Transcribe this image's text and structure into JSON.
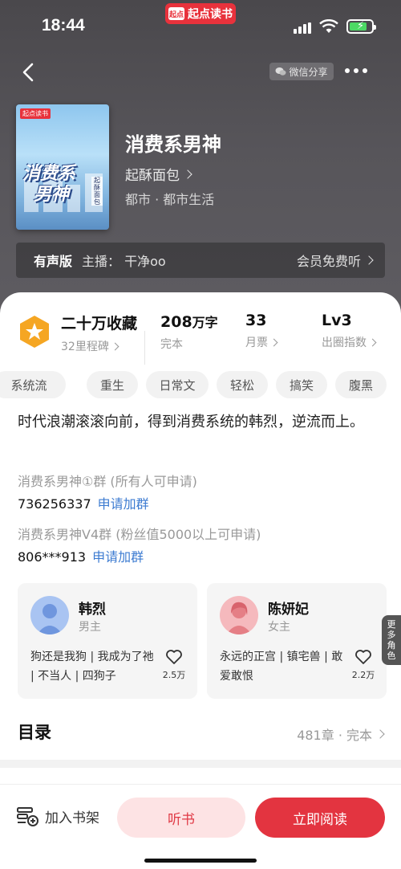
{
  "status": {
    "time": "18:44",
    "app_name": "起点读书",
    "app_logo": "起点"
  },
  "nav": {
    "share_label": "微信分享"
  },
  "book": {
    "cover_logo": "起点读书",
    "cover_title_line1": "消费系",
    "cover_title_line2": "男神",
    "cover_subtitle": "起酥面包",
    "title": "消费系男神",
    "author": "起酥面包",
    "genre": "都市 · 都市生活"
  },
  "audio": {
    "tag": "有声版",
    "anchor": "主播：  干净oo",
    "member": "会员免费听"
  },
  "stats": {
    "collect_value": "二十万收藏",
    "collect_label": "32里程碑",
    "words_value": "208",
    "words_unit": "万字",
    "words_label": "完本",
    "tickets_value": "33",
    "tickets_label": "月票",
    "level_value": "Lv3",
    "level_label": "出圈指数"
  },
  "tags": [
    "系统流",
    "重生",
    "日常文",
    "轻松",
    "搞笑",
    "腹黑"
  ],
  "synopsis": "时代浪潮滚滚向前，得到消费系统的韩烈，逆流而上。",
  "groups": [
    {
      "name": "消费系男神①群 (所有人可申请)",
      "id": "736256337",
      "link": "申请加群"
    },
    {
      "name": "消费系男神V4群 (粉丝值5000以上可申请)",
      "id": "806***913",
      "link": "申请加群"
    }
  ],
  "characters": [
    {
      "name": "韩烈",
      "role": "男主",
      "desc": "狗还是我狗 | 我成为了祂 | 不当人 | 四狗子",
      "likes": "2.5万"
    },
    {
      "name": "陈妍妃",
      "role": "女主",
      "desc": "永远的正宫 | 镇宅兽 | 敢爱敢恨",
      "likes": "2.2万"
    }
  ],
  "more_roles": "更多角色",
  "toc": {
    "title": "目录",
    "info": "481章 · 完本"
  },
  "bottom": {
    "shelf": "加入书架",
    "listen": "听书",
    "read": "立即阅读"
  },
  "colors": {
    "accent": "#e33440",
    "link": "#3c7bd1",
    "star": "#f5a623"
  }
}
